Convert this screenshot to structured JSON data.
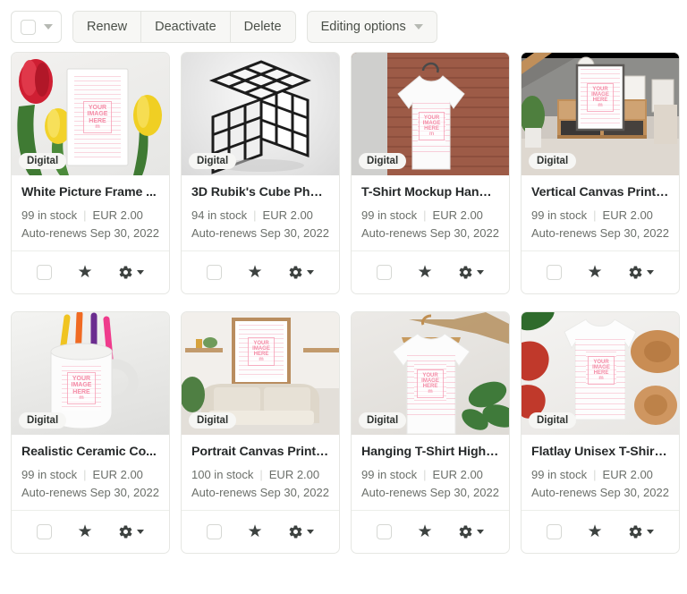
{
  "toolbar": {
    "select_all_label": "Select all",
    "buttons": [
      {
        "label": "Renew",
        "name": "renew-button"
      },
      {
        "label": "Deactivate",
        "name": "deactivate-button"
      },
      {
        "label": "Delete",
        "name": "delete-button"
      }
    ],
    "editing_options_label": "Editing options"
  },
  "card_footer": {
    "star_glyph": "★",
    "checkbox_name": "select-listing-checkbox",
    "star_name": "feature-listing-star",
    "gear_name": "listing-settings-gear"
  },
  "placeholder_art": {
    "line1": "YOUR",
    "line2": "IMAGE",
    "line3": "HERE",
    "mark": "m",
    "color": "#f48ba6"
  },
  "listings": [
    {
      "title": "White Picture Frame ...",
      "badge": "Digital",
      "stock": "99 in stock",
      "price": "EUR 2.00",
      "renews": "Auto-renews Sep 30, 2022",
      "scene": "tulips-frame"
    },
    {
      "title": "3D Rubik's Cube Phot...",
      "badge": "Digital",
      "stock": "94 in stock",
      "price": "EUR 2.00",
      "renews": "Auto-renews Sep 30, 2022",
      "scene": "rubiks-cube"
    },
    {
      "title": "T-Shirt Mockup Hangi...",
      "badge": "Digital",
      "stock": "99 in stock",
      "price": "EUR 2.00",
      "renews": "Auto-renews Sep 30, 2022",
      "scene": "tshirt-brick"
    },
    {
      "title": "Vertical Canvas Print ...",
      "badge": "Digital",
      "stock": "99 in stock",
      "price": "EUR 2.00",
      "renews": "Auto-renews Sep 30, 2022",
      "scene": "canvas-sideboard"
    },
    {
      "title": "Realistic Ceramic Co...",
      "badge": "Digital",
      "stock": "99 in stock",
      "price": "EUR 2.00",
      "renews": "Auto-renews Sep 30, 2022",
      "scene": "mug-pens"
    },
    {
      "title": "Portrait Canvas Print ...",
      "badge": "Digital",
      "stock": "100 in stock",
      "price": "EUR 2.00",
      "renews": "Auto-renews Sep 30, 2022",
      "scene": "canvas-sofa"
    },
    {
      "title": "Hanging T-Shirt High ...",
      "badge": "Digital",
      "stock": "99 in stock",
      "price": "EUR 2.00",
      "renews": "Auto-renews Sep 30, 2022",
      "scene": "tshirt-hanger-plant"
    },
    {
      "title": "Flatlay Unisex T-Shirt ...",
      "badge": "Digital",
      "stock": "99 in stock",
      "price": "EUR 2.00",
      "renews": "Auto-renews Sep 30, 2022",
      "scene": "tshirt-flatlay"
    }
  ]
}
